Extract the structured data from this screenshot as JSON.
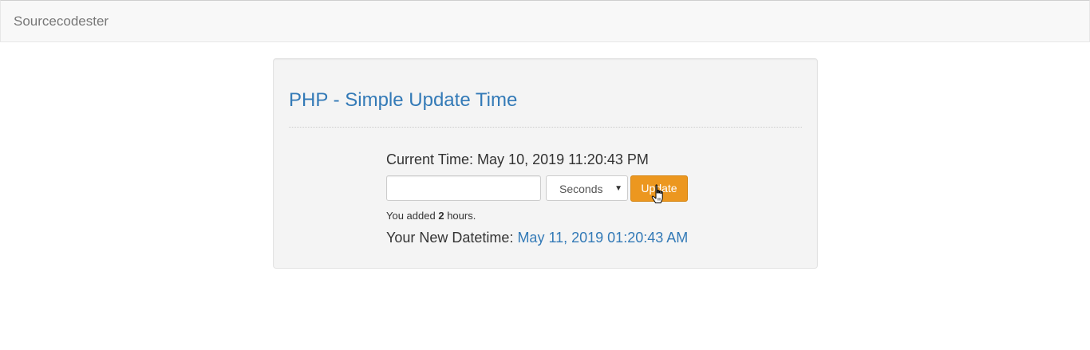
{
  "navbar": {
    "brand": "Sourcecodester"
  },
  "panel": {
    "title": "PHP - Simple Update Time",
    "current_time_label": "Current Time:",
    "current_time_value": "May 10, 2019 11:20:43 PM",
    "amount_input": {
      "value": "",
      "placeholder": ""
    },
    "unit_select": {
      "selected": "Seconds"
    },
    "update_button": "Update",
    "added_prefix": "You added",
    "added_amount": "2",
    "added_suffix": "hours.",
    "new_datetime_label": "Your New Datetime:",
    "new_datetime_value": "May 11, 2019 01:20:43 AM"
  },
  "colors": {
    "title": "#337ab7",
    "button": "#ec971f",
    "navbar_bg": "#f8f8f8",
    "well_bg": "#f4f4f4"
  },
  "icons": {
    "cursor": "hand-pointer-cursor-icon",
    "select_caret": "caret-down-icon"
  }
}
